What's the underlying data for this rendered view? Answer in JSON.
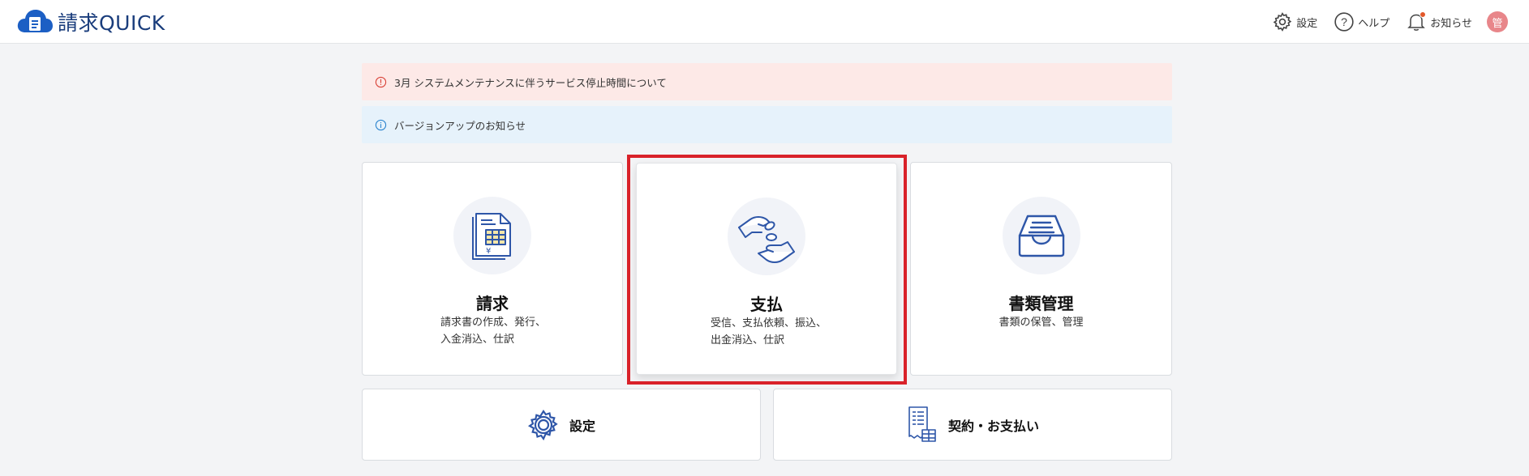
{
  "header": {
    "app_name": "請求QUICK",
    "settings_label": "設定",
    "help_label": "ヘルプ",
    "notifications_label": "お知らせ",
    "avatar_text": "管"
  },
  "alerts": [
    {
      "type": "error",
      "text": "3月 システムメンテナンスに伴うサービス停止時間について"
    },
    {
      "type": "info",
      "text": "バージョンアップのお知らせ"
    }
  ],
  "cards": {
    "billing": {
      "title": "請求",
      "desc_line1": "請求書の作成、発行、",
      "desc_line2": "入金消込、仕訳",
      "icon": "invoice-icon"
    },
    "payment": {
      "title": "支払",
      "desc_line1": "受信、支払依頼、振込、",
      "desc_line2": "出金消込、仕訳",
      "icon": "hand-payment-icon"
    },
    "documents": {
      "title": "書類管理",
      "desc_line1": "書類の保管、管理",
      "icon": "inbox-tray-icon"
    }
  },
  "bottom": {
    "settings_label": "設定",
    "contract_label": "契約・お支払い"
  },
  "colors": {
    "brand": "#1a3d7c",
    "icon_blue": "#2e56a8",
    "highlight": "#d9222a",
    "alert_error_bg": "#fde9e7",
    "alert_info_bg": "#e6f2fb"
  }
}
